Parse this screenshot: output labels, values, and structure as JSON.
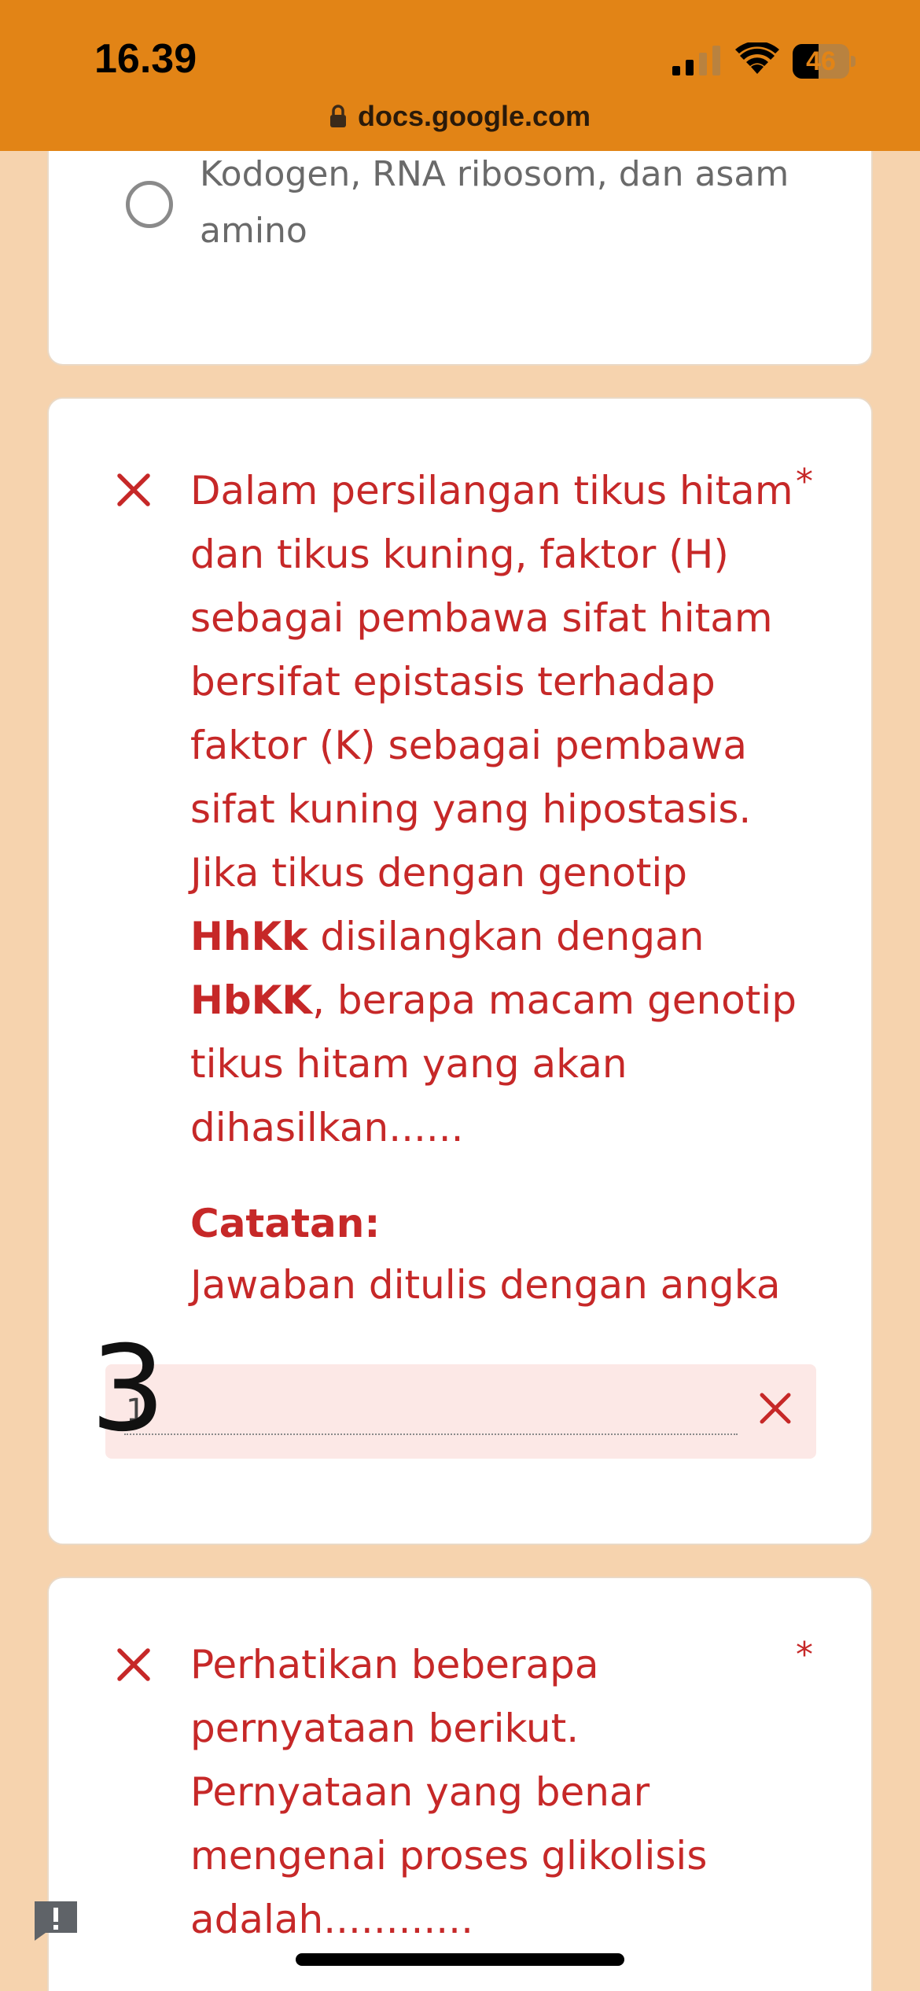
{
  "status_bar": {
    "time": "16.39",
    "battery": "46",
    "battery_level": 0.46
  },
  "browser": {
    "url": "docs.google.com"
  },
  "previous_card": {
    "option_text": "Kodogen, RNA ribosom, dan asam amino"
  },
  "question_1": {
    "required_mark": "*",
    "text_before_1": "Dalam persilangan tikus hitam dan tikus kuning, faktor (H) sebagai pembawa sifat hitam bersifat epistasis terhadap faktor (K) sebagai pembawa sifat kuning yang hipostasis. Jika tikus dengan genotip ",
    "bold_1": "HhKk",
    "text_between": " disilangkan dengan ",
    "bold_2": "HbKK",
    "text_after": ", berapa macam genotip tikus hitam yang akan dihasilkan......",
    "note_title": "Catatan:",
    "note_text": "Jawaban ditulis dengan angka",
    "answer_value": "1",
    "handwritten_mark": "3"
  },
  "question_2": {
    "required_mark": "*",
    "text": "Perhatikan beberapa pernyataan berikut. Pernyataan yang benar mengenai proses glikolisis adalah............"
  },
  "colors": {
    "status_bar_bg": "#e28416",
    "page_bg": "#f6d3ae",
    "error_red": "#c62828",
    "answer_bg": "#fce8e6"
  }
}
